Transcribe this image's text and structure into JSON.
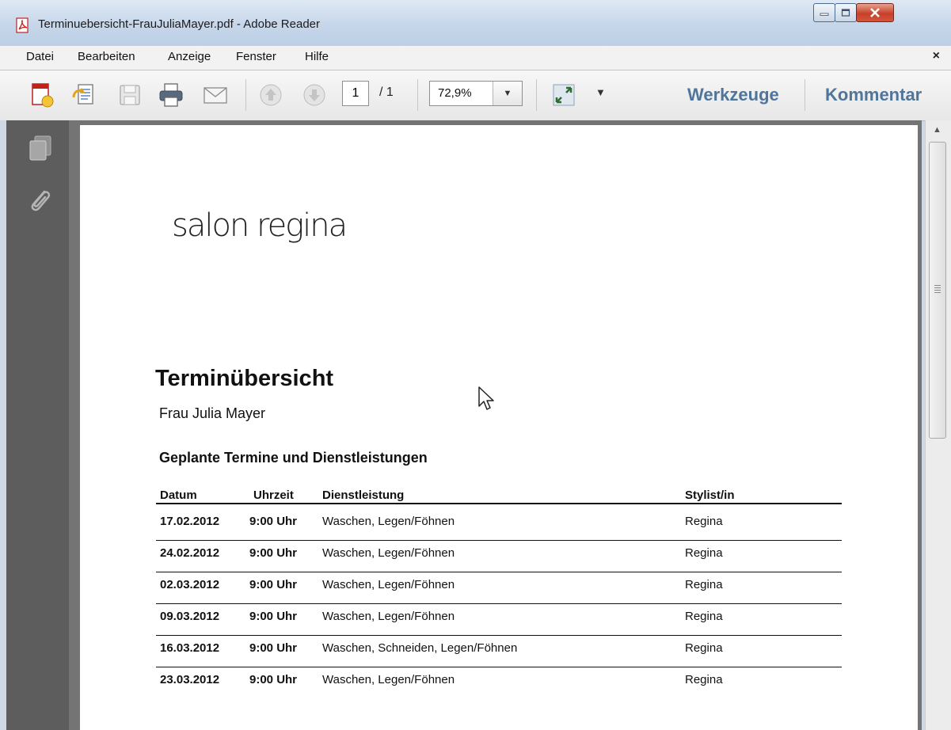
{
  "window": {
    "title": "Terminuebersicht-FrauJuliaMayer.pdf - Adobe Reader"
  },
  "menu": {
    "items": [
      "Datei",
      "Bearbeiten",
      "Anzeige",
      "Fenster",
      "Hilfe"
    ],
    "close": "×"
  },
  "toolbar": {
    "page_current": "1",
    "page_total": "/ 1",
    "zoom": "72,9%",
    "tools_label": "Werkzeuge",
    "comment_label": "Kommentar"
  },
  "document": {
    "logo": "salon regina",
    "title": "Terminübersicht",
    "subtitle": "Frau Julia Mayer",
    "section": "Geplante Termine und Dienstleistungen",
    "table": {
      "headers": [
        "Datum",
        "Uhrzeit",
        "Dienstleistung",
        "Stylist/in"
      ],
      "rows": [
        [
          "17.02.2012",
          "9:00 Uhr",
          "Waschen, Legen/Föhnen",
          "Regina"
        ],
        [
          "24.02.2012",
          "9:00 Uhr",
          "Waschen, Legen/Föhnen",
          "Regina"
        ],
        [
          "02.03.2012",
          "9:00 Uhr",
          "Waschen, Legen/Föhnen",
          "Regina"
        ],
        [
          "09.03.2012",
          "9:00 Uhr",
          "Waschen, Legen/Föhnen",
          "Regina"
        ],
        [
          "16.03.2012",
          "9:00 Uhr",
          "Waschen, Schneiden, Legen/Föhnen",
          "Regina"
        ],
        [
          "23.03.2012",
          "9:00 Uhr",
          "Waschen, Legen/Föhnen",
          "Regina"
        ]
      ]
    }
  },
  "icons": {
    "toolbar": [
      "create-pdf-icon",
      "open-file-icon",
      "save-icon",
      "print-icon",
      "email-icon",
      "page-up-icon",
      "page-down-icon",
      "fit-expand-icon"
    ],
    "sidebar": [
      "page-thumbnails-icon",
      "attachment-icon"
    ]
  },
  "colors": {
    "accent_text": "#50759a",
    "sidebar": "#5d5d5d",
    "doc_background": "#747474",
    "close_button": "#c7412a"
  }
}
